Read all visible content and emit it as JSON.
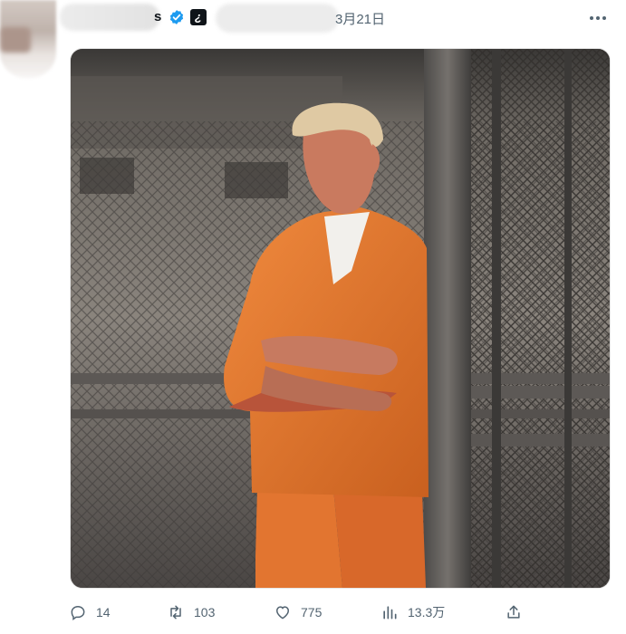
{
  "header": {
    "name_tail": "s",
    "date": "3月21日",
    "verified_icon": "verified-badge-icon",
    "affiliation_icon": "affiliate-badge-icon",
    "affiliation_glyph": "¿",
    "more_icon": "more-horizontal-icon"
  },
  "image": {
    "subject": "man in orange prison jumpsuit leaning against a post inside a fenced jail yard",
    "colors": {
      "jumpsuit": "#e5782f",
      "fence": "#4b4846",
      "skin": "#c97a5f",
      "hair": "#d9c5a0"
    }
  },
  "actions": {
    "reply": {
      "icon": "reply-icon",
      "count": "14"
    },
    "repost": {
      "icon": "repost-icon",
      "count": "103"
    },
    "like": {
      "icon": "like-heart-icon",
      "count": "775"
    },
    "views": {
      "icon": "views-chart-icon",
      "count": "13.3万"
    },
    "share": {
      "icon": "share-icon"
    }
  }
}
